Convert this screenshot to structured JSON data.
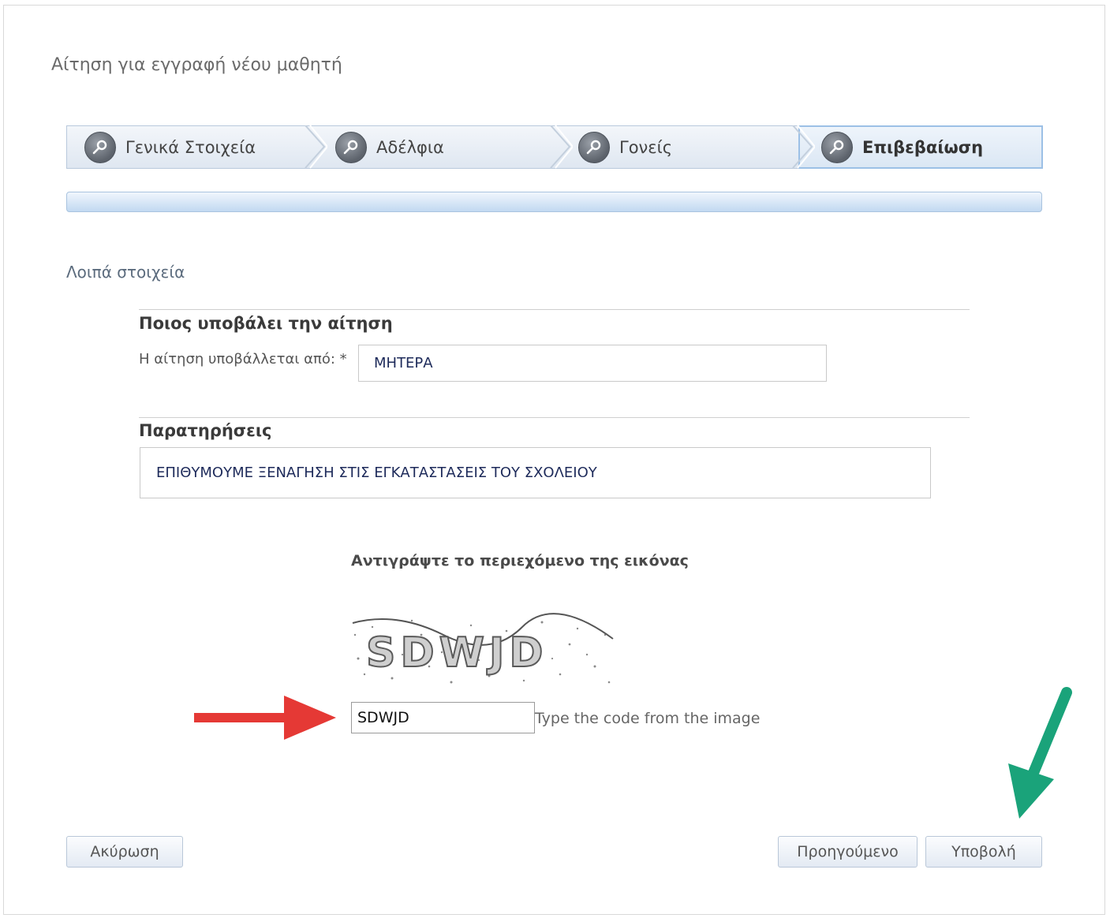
{
  "page": {
    "title": "Αίτηση για εγγραφή νέου μαθητή"
  },
  "wizard": {
    "steps": [
      {
        "label": "Γενικά Στοιχεία",
        "icon": "key-icon"
      },
      {
        "label": "Αδέλφια",
        "icon": "key-icon"
      },
      {
        "label": "Γονείς",
        "icon": "key-icon"
      },
      {
        "label": "Επιβεβαίωση",
        "icon": "key-icon",
        "active": true
      }
    ]
  },
  "section": {
    "heading": "Λοιπά στοιχεία"
  },
  "submitter": {
    "title": "Ποιος υποβάλει την αίτηση",
    "label": "Η αίτηση υποβάλλεται από: *",
    "value": "ΜΗΤΕΡΑ"
  },
  "notes": {
    "title": "Παρατηρήσεις",
    "value": "ΕΠΙΘΥΜΟΥΜΕ ΞΕΝΑΓΗΣΗ ΣΤΙΣ ΕΓΚΑΤΑΣΤΑΣΕΙΣ ΤΟΥ ΣΧΟΛΕΙΟΥ"
  },
  "captcha": {
    "instruction": "Αντιγράψτε το περιεχόμενο της εικόνας",
    "image_text": "SDWJD",
    "input_value": "SDWJD",
    "hint": "Type the code from the image"
  },
  "buttons": {
    "cancel": "Ακύρωση",
    "previous": "Προηγούμενο",
    "submit": "Υποβολή"
  },
  "annotations": {
    "red_arrow_color": "#e53935",
    "green_arrow_color": "#1aa37a"
  }
}
